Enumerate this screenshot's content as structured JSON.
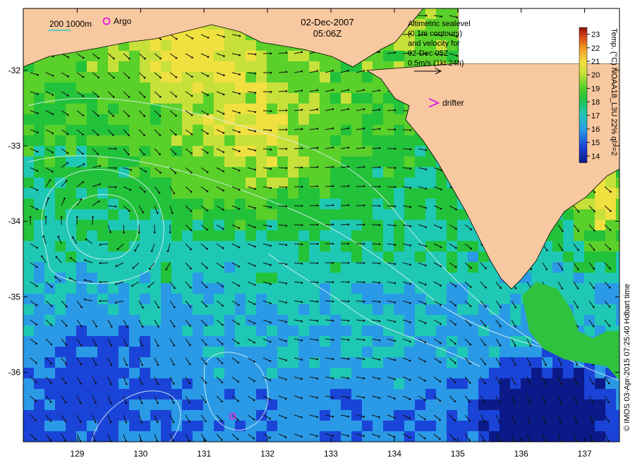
{
  "map": {
    "date": "02-Dec-2007",
    "time": "05:06Z",
    "lon_ticks": [
      "129",
      "130",
      "131",
      "132",
      "133",
      "134",
      "135",
      "136",
      "137"
    ],
    "lat_ticks": [
      "-32",
      "-33",
      "-34",
      "-35",
      "-36"
    ],
    "lon_range": [
      128.15,
      137.55
    ],
    "lat_range": [
      -36.92,
      -31.18
    ],
    "land_color": "#f8c8a0",
    "contour_color": "#d8f0f0"
  },
  "legend_top_left": {
    "depth_label": "200  1000m",
    "argo_label": "Argo",
    "argo_color": "#e020e0",
    "isobath_color": "#30c8c8"
  },
  "altimetry_note": {
    "lines": [
      "Altimetric sealevel",
      "(0.1m contours)",
      "and velocity for",
      "02-Dec 05Z",
      "0.5m/s (1kt 24h)"
    ]
  },
  "drifter": {
    "label": "drifter",
    "color": "#e020e0"
  },
  "argo_float": {
    "lon": 131.45,
    "lat": -36.58
  },
  "colorbar": {
    "ticks": [
      "23",
      "22",
      "21",
      "20",
      "19",
      "18",
      "17",
      "16",
      "15",
      "14"
    ],
    "title": "Temp. (°C) NOAA18_L3U  22% ql>=2",
    "min": 13.5,
    "max": 23.5
  },
  "credit": "© IMOS 03-Apr-2015 07:25:40 Hdbart time"
}
